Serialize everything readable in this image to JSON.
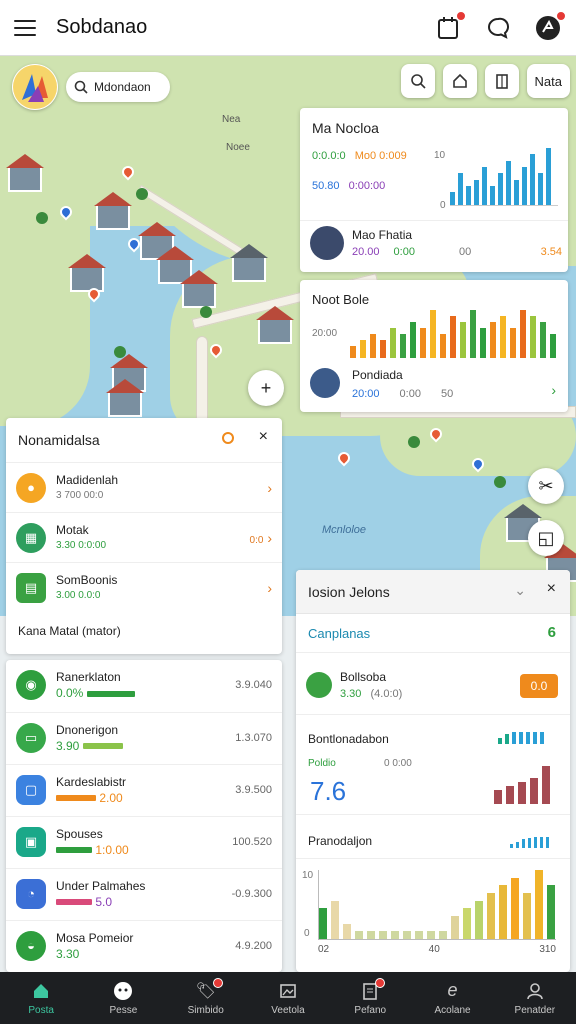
{
  "header": {
    "title": "Sobdanao",
    "menu_icon": "menu-icon",
    "icons": [
      "calendar-icon",
      "chat-icon",
      "profile-icon"
    ]
  },
  "map": {
    "search_text": "Mdondaon",
    "tools": [
      "search-icon",
      "home-icon",
      "building-icon"
    ],
    "tool_text": "Nata",
    "labels": {
      "a": "Nea",
      "b": "Noee",
      "water": "Mcnloloe"
    }
  },
  "overview_card": {
    "title": "Ma Nocloa",
    "stats": [
      {
        "label": "0:0.0:0",
        "value": "Mo0 0:009"
      },
      {
        "label": "50.80",
        "value": "0:00:00"
      }
    ],
    "axis_top": "10",
    "axis_bottom": "0",
    "bar_values": [
      2,
      5,
      3,
      4,
      6,
      3,
      5,
      7,
      4,
      6,
      8,
      5,
      9
    ],
    "person_name": "Mao Fhatia",
    "person_stats": [
      "20.00",
      "0:00",
      "00",
      "3.54"
    ]
  },
  "activity_card": {
    "title": "Noot Bole",
    "axis_label": "20:00",
    "bar_values": [
      2,
      3,
      4,
      3,
      5,
      4,
      6,
      5,
      8,
      4,
      7,
      6,
      8,
      5,
      6,
      7,
      5,
      8,
      7,
      6,
      4
    ],
    "person_name": "Pondiada",
    "person_stats": [
      "20:00",
      "0:00",
      "50"
    ]
  },
  "left_panel": {
    "title": "Nonamidalsa",
    "rows": [
      {
        "name": "Madidenlah",
        "sub": "3 700  00:0"
      },
      {
        "name": "Motak",
        "sub": "3.30  0:0:00",
        "extra": "0:0"
      },
      {
        "name": "SomBoonis",
        "sub": "3.00  0.0:0"
      }
    ],
    "footer": "Kana Matal (mator)"
  },
  "stats_list": [
    {
      "name": "Ranerklaton",
      "value": "0.0%",
      "right": "3.9.040"
    },
    {
      "name": "Dnonerigon",
      "value": "3.90",
      "right": "1.3.070"
    },
    {
      "name": "Kardeslabistr",
      "value": "2.00",
      "right": "3.9.500"
    },
    {
      "name": "Spouses",
      "value": "1:0.00",
      "right": "100.520"
    },
    {
      "name": "Under Palmahes",
      "value": "5.0",
      "right": "-0.9.300"
    },
    {
      "name": "Mosa Pomeior",
      "value": "3.30",
      "right": "4.9.200"
    }
  ],
  "right_panel": {
    "title": "Iosion Jelons",
    "link": "Canplanas",
    "link_badge": "6",
    "item_name": "Bollsoba",
    "item_value": "3.30",
    "item_sub": "(4.0:0)",
    "item_badge": "0.0",
    "section1_title": "Bontlonadabon",
    "section1_sub": "Poldio",
    "section1_sub2": "0 0:00",
    "big_number": "7.6",
    "section2_title": "Pranodaljon",
    "chart_axis": [
      "10",
      "0"
    ],
    "x_labels": [
      "02",
      "40",
      "310"
    ],
    "bar_values": [
      4,
      5,
      2,
      1,
      1,
      1,
      1,
      1,
      1,
      1,
      1,
      3,
      4,
      5,
      6,
      7,
      8,
      6,
      9,
      7
    ]
  },
  "bottom_nav": [
    {
      "label": "Posta",
      "icon": "home-icon"
    },
    {
      "label": "Pesse",
      "icon": "face-icon"
    },
    {
      "label": "Simbido",
      "icon": "tag-icon"
    },
    {
      "label": "Veetola",
      "icon": "image-icon"
    },
    {
      "label": "Pefano",
      "icon": "document-icon"
    },
    {
      "label": "Acolane",
      "icon": "e-icon"
    },
    {
      "label": "Penatder",
      "icon": "person-icon"
    }
  ]
}
